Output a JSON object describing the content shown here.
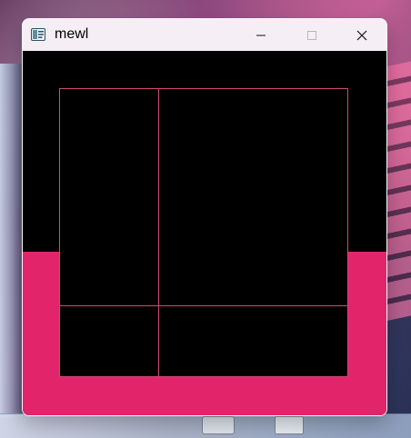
{
  "window": {
    "title": "mewl",
    "colors": {
      "titlebar_bg": "#f6eef5",
      "canvas_bg": "#000000",
      "band_color": "#e2246b",
      "line_color": "#d14a72"
    }
  },
  "controls": {
    "minimize_icon": "minimize-icon",
    "maximize_icon": "maximize-icon",
    "close_icon": "close-icon"
  }
}
